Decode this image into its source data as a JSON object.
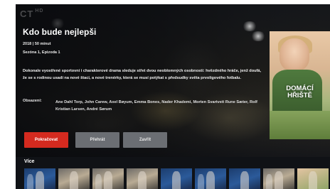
{
  "channel": {
    "logo_text": "CT",
    "logo_sub": "HD"
  },
  "show": {
    "title": "Kdo bude nejlepši",
    "year_duration": "2018 | 50 minut",
    "season_episode": "Sezóna 1, Epizoda 1",
    "description": "Dokonale vyostřené sportovní i charakterové drama sleduje střet dvou neoblomných osobností: hvězdného hráče, jenž doufá, že se s rodinou usadí na nové štaci, a nové trenérky, která se musí potýkat s předsudky světa prvoligového fotbalu.",
    "cast_label": "Obsazení:",
    "cast": "Ane Dahl Torp, John Carew, Axel Bøyum, Emma Bones, Nader Khademi, Morten Svartveit Rune Sæter, Rolf Kristian Larsen, André Sørum"
  },
  "buttons": {
    "continue": "Pokračovat",
    "play": "Přehrát",
    "close": "Zavřít"
  },
  "poster": {
    "title_line1": "DOMÁCÍ",
    "title_line2": "HŘIŠTĚ"
  },
  "more": {
    "label": "Více"
  },
  "colors": {
    "primary_button": "#d42a1f",
    "secondary_button": "#6b6e73",
    "background": "#0b0d11"
  }
}
